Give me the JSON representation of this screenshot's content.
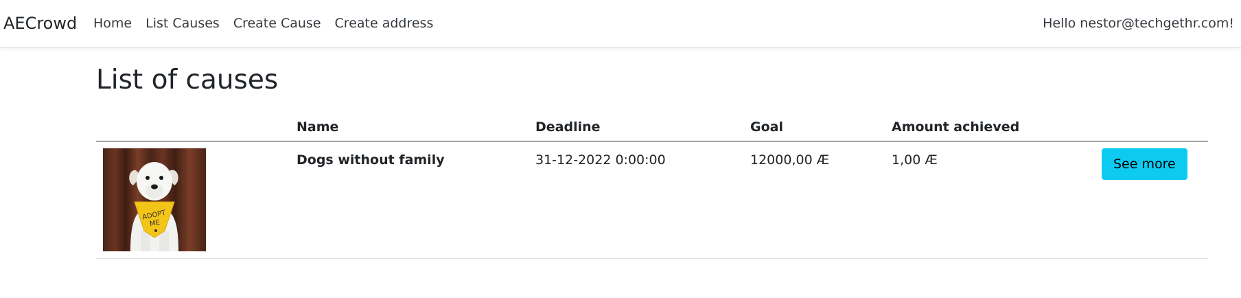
{
  "navbar": {
    "brand": "AECrowd",
    "links": [
      {
        "label": "Home"
      },
      {
        "label": "List Causes"
      },
      {
        "label": "Create Cause"
      },
      {
        "label": "Create address"
      }
    ],
    "greeting": "Hello nestor@techgethr.com!"
  },
  "main": {
    "title": "List of causes",
    "table": {
      "headers": [
        "",
        "Name",
        "Deadline",
        "Goal",
        "Amount achieved",
        ""
      ],
      "rows": [
        {
          "image_icon": "dog-photo-adopt-me",
          "name": "Dogs without family",
          "deadline": "31-12-2022 0:00:00",
          "goal": "12000,00 Æ",
          "amount": "1,00 Æ",
          "action_label": "See more"
        }
      ]
    },
    "bandana_text": "ADOPT ME"
  },
  "colors": {
    "accent_button": "#0dcaf0",
    "text": "#212529"
  }
}
